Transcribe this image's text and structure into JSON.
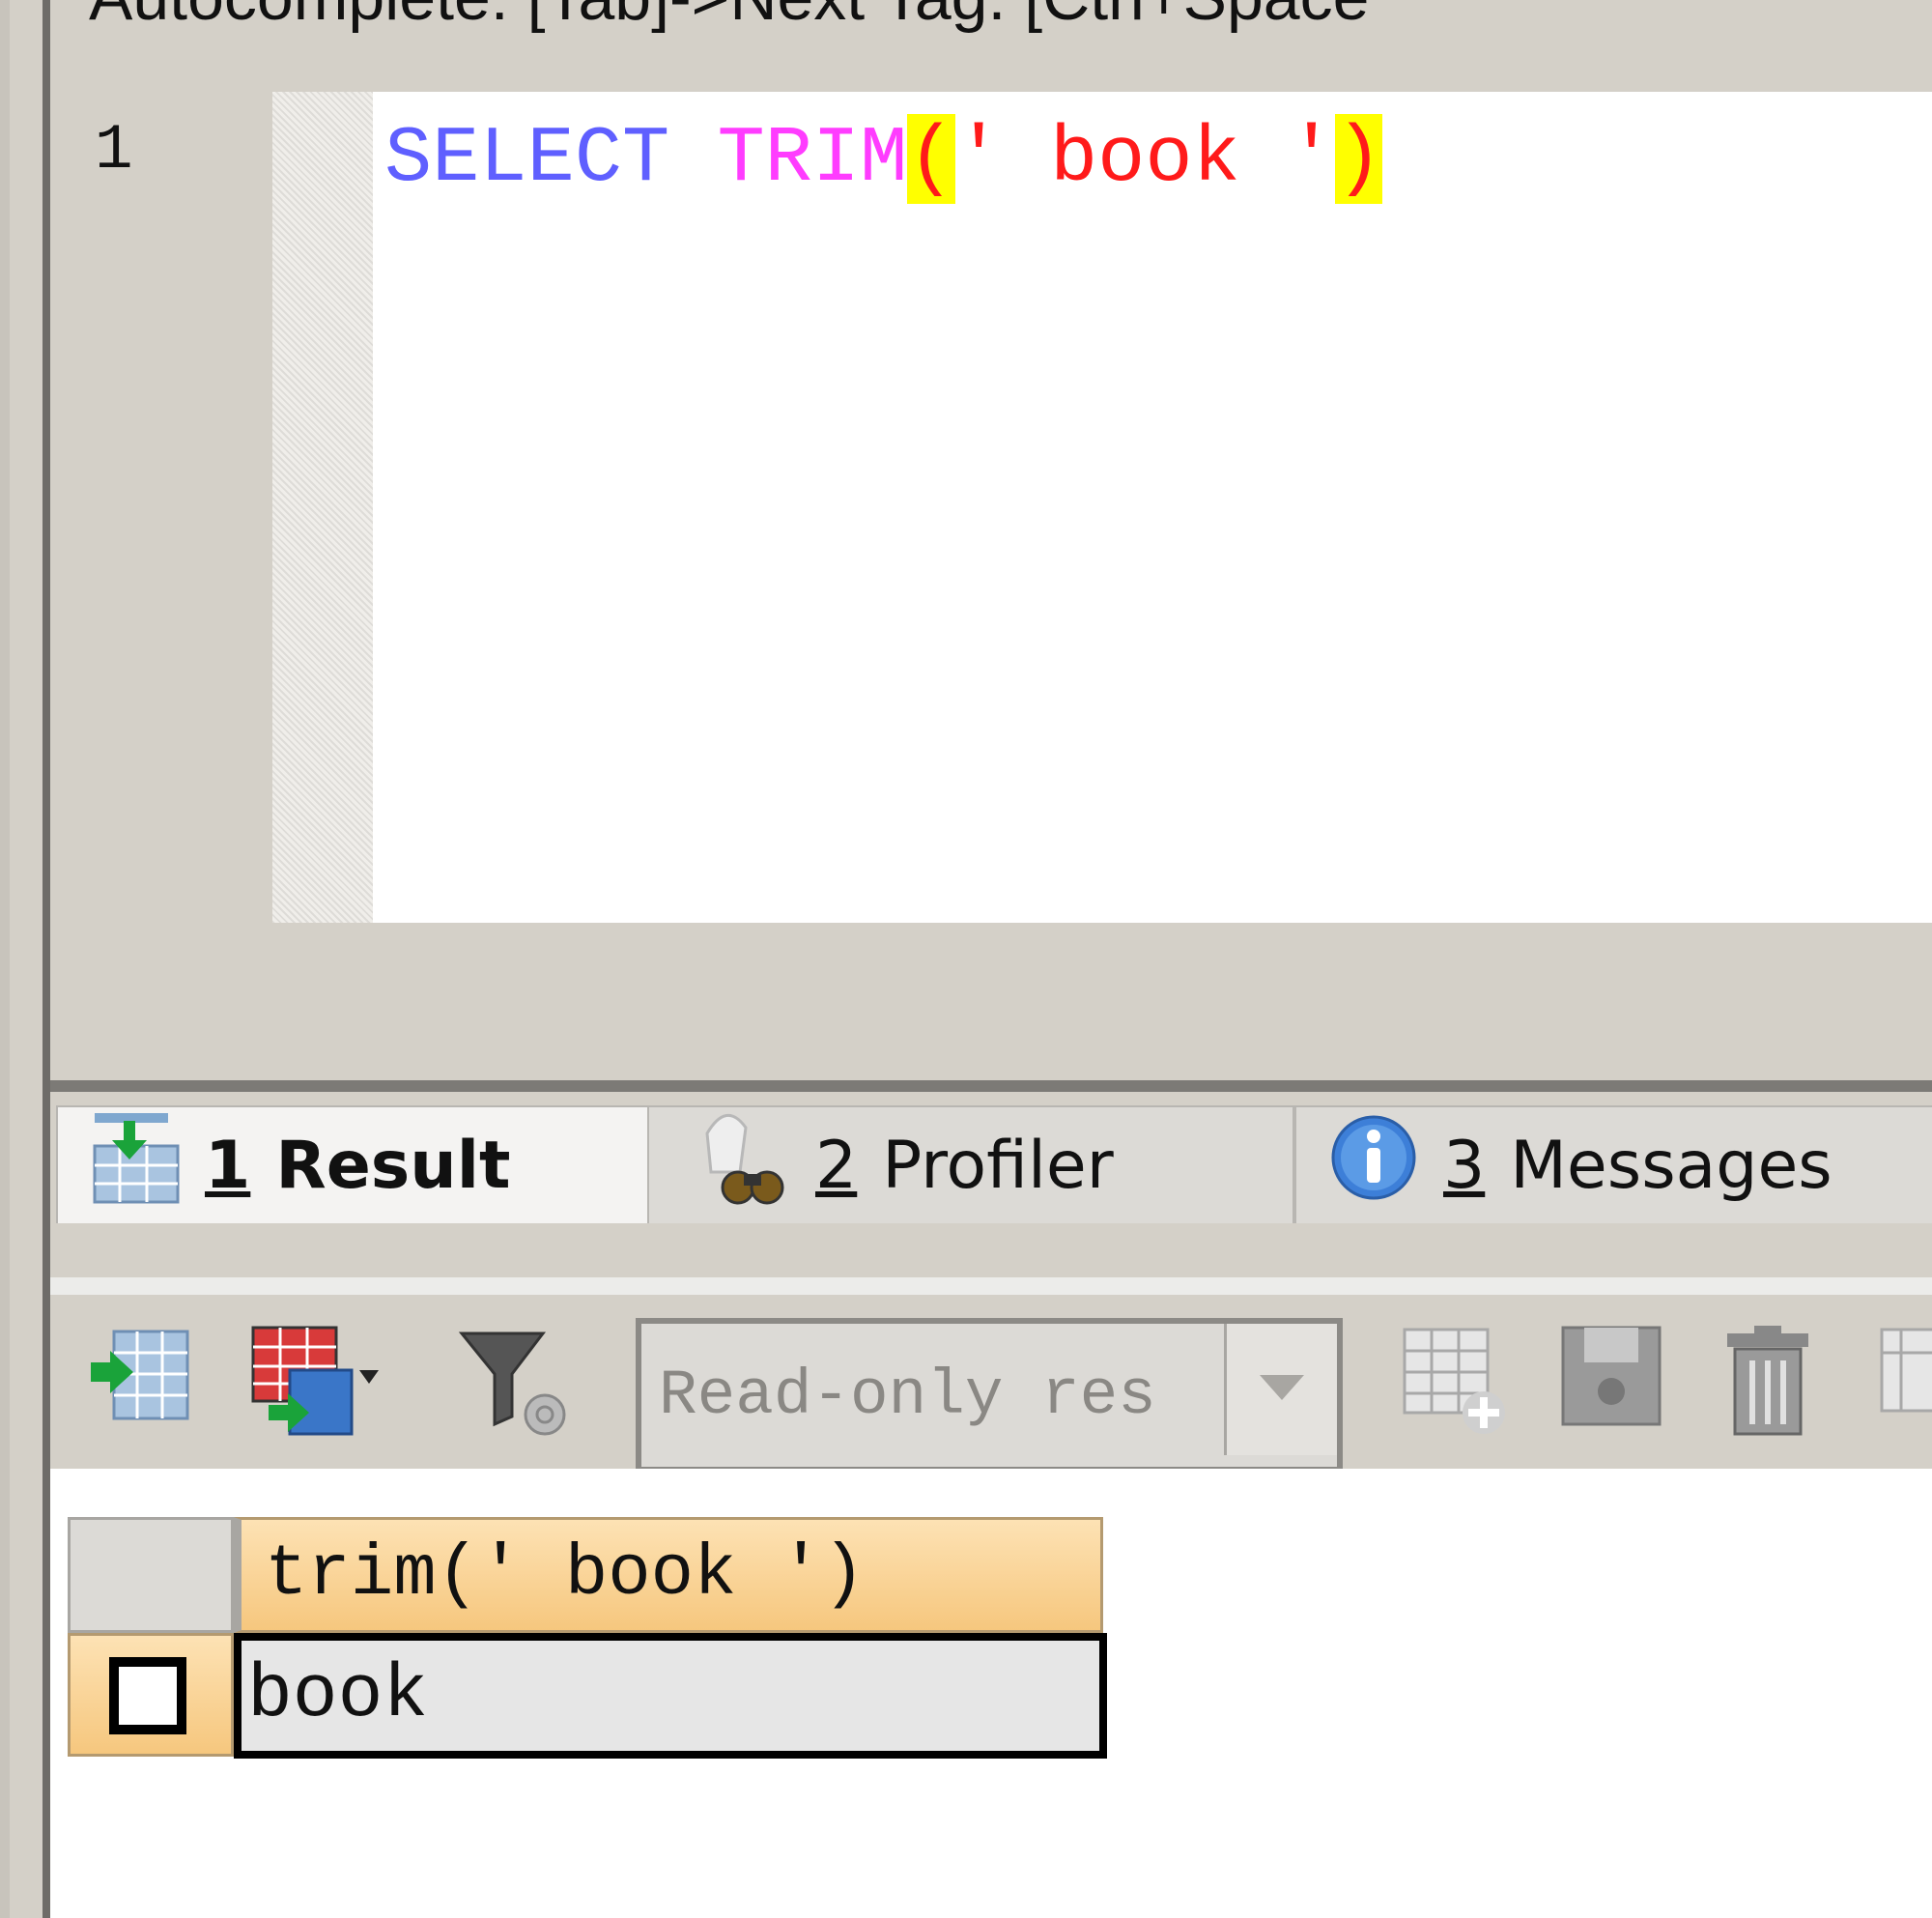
{
  "hint_bar": {
    "text": "Autocomplete: [Tab]->Next Tag. [Ctrl+Space"
  },
  "editor": {
    "line_number": "1",
    "code_tokens": {
      "keyword": "SELECT",
      "space1": " ",
      "function": "TRIM",
      "open_paren": "(",
      "string": "' book '",
      "close_paren": ")"
    }
  },
  "tabs": [
    {
      "number": "1",
      "label": "Result",
      "icon": "result-grid-icon",
      "active": true
    },
    {
      "number": "2",
      "label": "Profiler",
      "icon": "profiler-binoculars-icon",
      "active": false
    },
    {
      "number": "3",
      "label": "Messages",
      "icon": "info-icon",
      "active": false
    }
  ],
  "toolbar": {
    "mode_select_value": "Read-only res",
    "icons": [
      "export-icon",
      "grid-export-icon",
      "filter-icon",
      "mode-dropdown-icon",
      "add-row-icon",
      "save-icon",
      "delete-icon",
      "copy-icon"
    ]
  },
  "grid": {
    "column_header": "trim(' book ')",
    "rows": [
      {
        "value": "book"
      }
    ]
  },
  "colors": {
    "keyword": "#5f5fff",
    "function": "#ff3cff",
    "string": "#ff1a1a",
    "paren_match_highlight": "#ffff00",
    "header_gradient": "#f6c77e"
  }
}
